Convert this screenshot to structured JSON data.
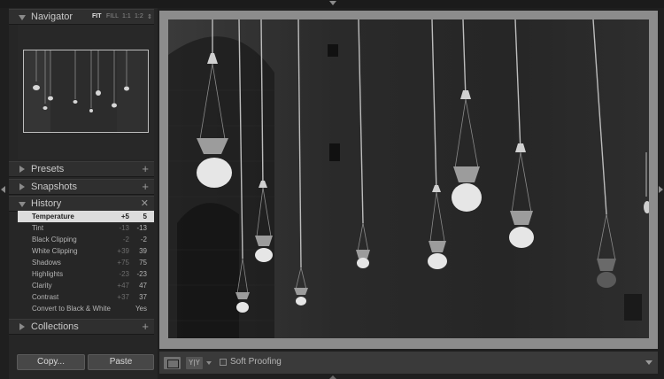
{
  "navigator": {
    "title": "Navigator",
    "zoom_options": [
      "FIT",
      "FILL",
      "1:1",
      "1:2"
    ],
    "zoom_active": "FIT"
  },
  "panels": {
    "presets": "Presets",
    "snapshots": "Snapshots",
    "history": "History",
    "collections": "Collections"
  },
  "history": {
    "items": [
      {
        "name": "Temperature",
        "a": "+5",
        "b": "5",
        "selected": true
      },
      {
        "name": "Tint",
        "a": "-13",
        "b": "-13"
      },
      {
        "name": "Black Clipping",
        "a": "-2",
        "b": "-2"
      },
      {
        "name": "White Clipping",
        "a": "+39",
        "b": "39"
      },
      {
        "name": "Shadows",
        "a": "+75",
        "b": "75"
      },
      {
        "name": "Highlights",
        "a": "-23",
        "b": "-23"
      },
      {
        "name": "Clarity",
        "a": "+47",
        "b": "47"
      },
      {
        "name": "Contrast",
        "a": "+37",
        "b": "37"
      },
      {
        "name": "Convert to Black & White",
        "a": "",
        "b": "Yes"
      }
    ]
  },
  "buttons": {
    "copy": "Copy...",
    "paste": "Paste"
  },
  "toolbar": {
    "yy_label": "Y|Y",
    "soft_proofing": "Soft Proofing"
  },
  "icons": {
    "expand": "triangle-right-icon",
    "collapse": "triangle-down-icon",
    "add": "plus-icon",
    "clear": "close-icon"
  }
}
